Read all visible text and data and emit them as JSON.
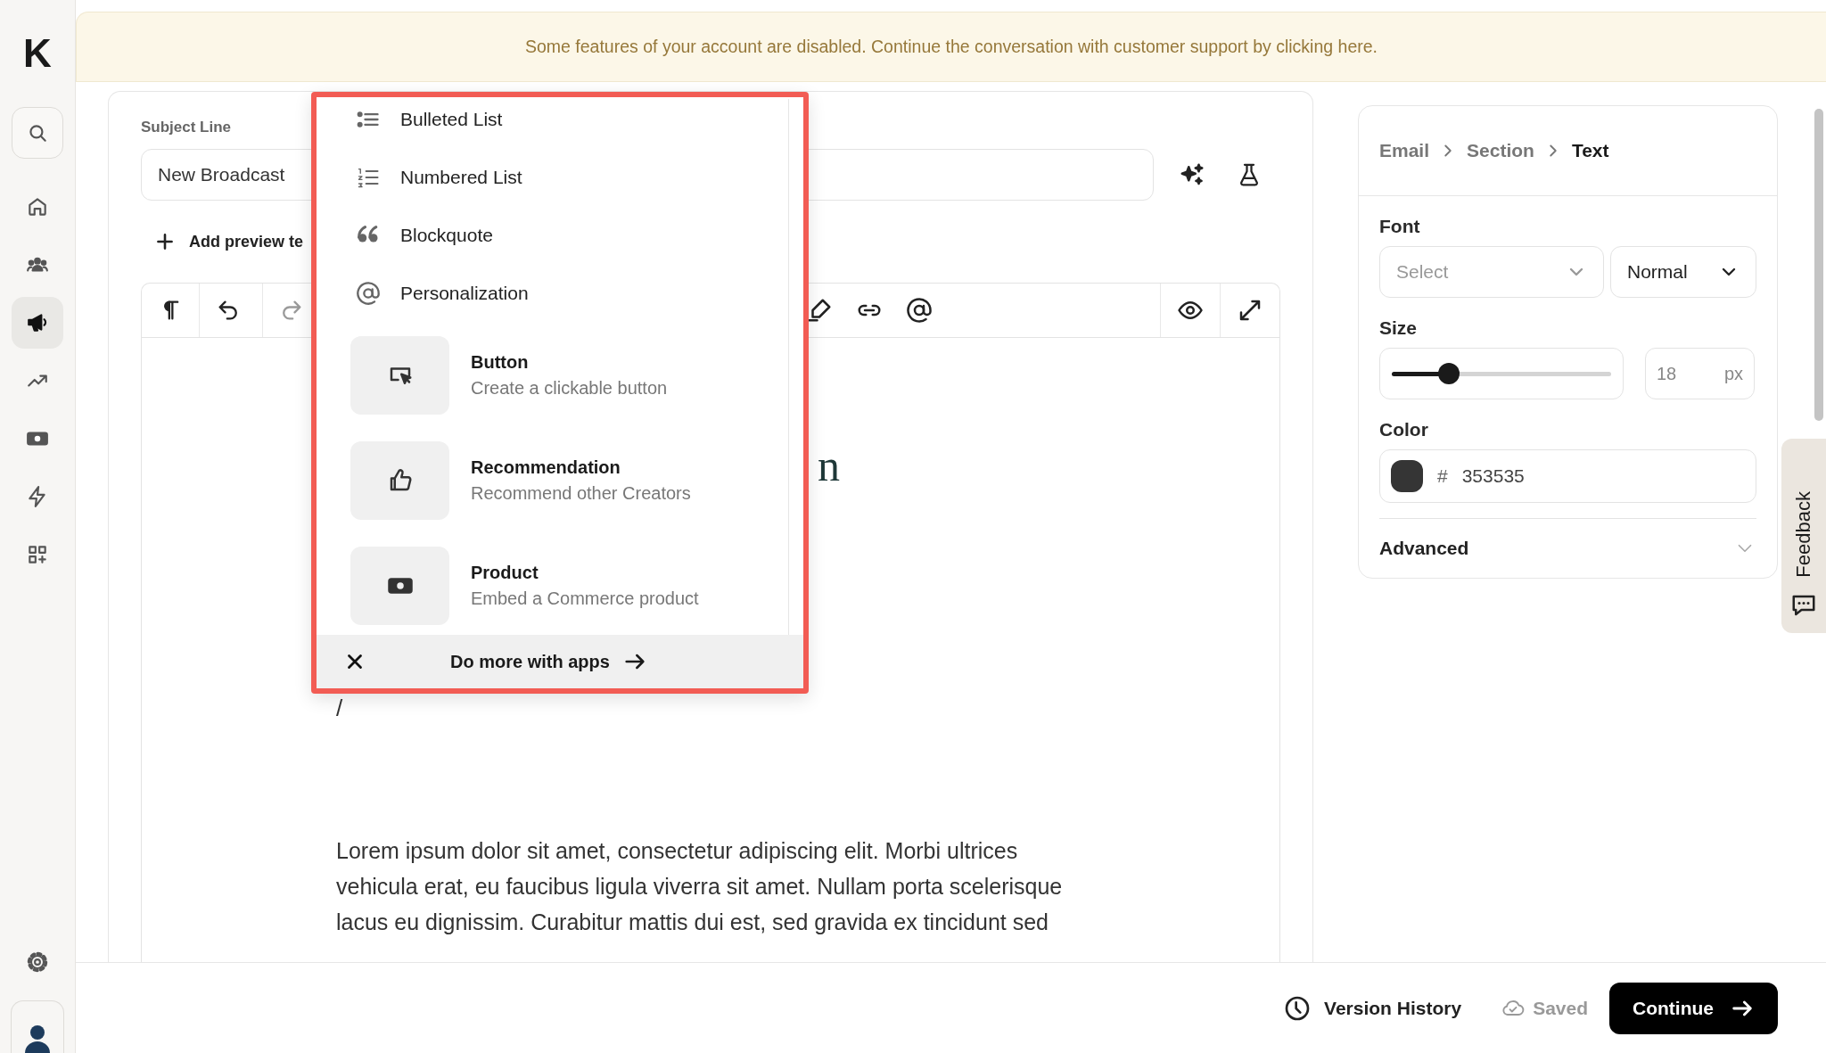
{
  "sidebar": {
    "logo": "K",
    "nav": [
      {
        "kind": "search",
        "selected": false
      },
      {
        "kind": "home",
        "selected": false
      },
      {
        "kind": "people",
        "selected": false
      },
      {
        "kind": "megaphone",
        "selected": true
      },
      {
        "kind": "trend",
        "selected": false
      },
      {
        "kind": "money",
        "selected": false
      },
      {
        "kind": "bolt",
        "selected": false
      },
      {
        "kind": "apps",
        "selected": false
      }
    ],
    "bottom": [
      {
        "kind": "settings"
      },
      {
        "kind": "avatar"
      }
    ]
  },
  "banner": {
    "text": "Some features of your account are disabled. Continue the conversation with customer support by clicking here."
  },
  "subject": {
    "label": "Subject Line",
    "value": "New Broadcast"
  },
  "preview": {
    "label": "Add preview te"
  },
  "toolbar": {
    "left": [
      {
        "kind": "paragraph",
        "disabled": false
      },
      {
        "kind": "undo",
        "disabled": false
      },
      {
        "kind": "redo",
        "disabled": true
      }
    ],
    "right": [
      {
        "kind": "highlight",
        "disabled": false
      },
      {
        "kind": "link",
        "disabled": false
      },
      {
        "kind": "mention",
        "disabled": false
      },
      {
        "kind": "preview",
        "disabled": false
      },
      {
        "kind": "expand",
        "disabled": false
      }
    ]
  },
  "editor": {
    "heading_fragment": "n",
    "slash": "/",
    "paragraph": "Lorem ipsum dolor sit amet, consectetur adipiscing elit. Morbi ultrices vehicula erat, eu faucibus ligula viverra sit amet. Nullam porta scelerisque lacus eu dignissim. Curabitur mattis dui est, sed gravida ex tincidunt sed"
  },
  "menu": {
    "items": [
      {
        "kind": "bulleted",
        "label": "Bulleted List"
      },
      {
        "kind": "numbered",
        "label": "Numbered List"
      },
      {
        "kind": "quote",
        "label": "Blockquote"
      },
      {
        "kind": "mention",
        "label": "Personalization"
      }
    ],
    "cards": [
      {
        "kind": "button",
        "title": "Button",
        "description": "Create a clickable button"
      },
      {
        "kind": "recommendation",
        "title": "Recommendation",
        "description": "Recommend other Creators"
      },
      {
        "kind": "product",
        "title": "Product",
        "description": "Embed a Commerce product"
      }
    ],
    "footer": {
      "label": "Do more with apps"
    }
  },
  "panel": {
    "breadcrumb": [
      {
        "label": "Email",
        "selected": false
      },
      {
        "label": "Section",
        "selected": false
      },
      {
        "label": "Text",
        "selected": true
      }
    ],
    "font": {
      "label": "Font",
      "placeholder": "Select",
      "weight": "Normal"
    },
    "size": {
      "label": "Size",
      "level": 0.26,
      "placeholder": "18",
      "unit": "px"
    },
    "color": {
      "label": "Color",
      "hash": "#",
      "value": "353535"
    },
    "advanced": {
      "label": "Advanced",
      "expanded": false
    }
  },
  "feedback": {
    "label": "Feedback"
  },
  "footer": {
    "version_history": "Version History",
    "saved": "Saved",
    "continue": "Continue"
  }
}
